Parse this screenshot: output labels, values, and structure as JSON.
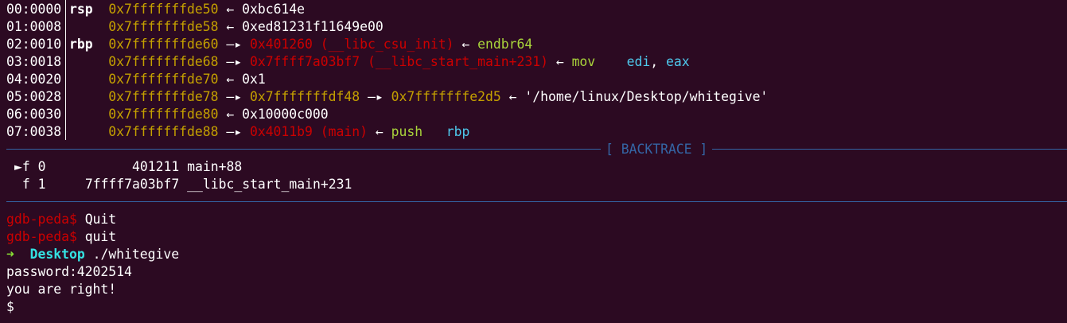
{
  "stack": [
    {
      "offset": "00:0000",
      "reg": "rsp",
      "addr": "0x7fffffffde50",
      "arrow": "←",
      "val": "0xbc614e"
    },
    {
      "offset": "01:0008",
      "reg": "",
      "addr": "0x7fffffffde58",
      "arrow": "←",
      "val": "0xed81231f11649e00"
    },
    {
      "offset": "02:0010",
      "reg": "rbp",
      "addr": "0x7fffffffde60",
      "arrow": "—▸",
      "val": "0x401260 (__libc_csu_init)",
      "arrow2": "←",
      "instr": "endbr64"
    },
    {
      "offset": "03:0018",
      "reg": "",
      "addr": "0x7fffffffde68",
      "arrow": "—▸",
      "val": "0x7ffff7a03bf7 (__libc_start_main+231)",
      "arrow2": "←",
      "instr": "mov",
      "op1": "edi",
      "comma": ",",
      "op2": "eax"
    },
    {
      "offset": "04:0020",
      "reg": "",
      "addr": "0x7fffffffde70",
      "arrow": "←",
      "val": "0x1"
    },
    {
      "offset": "05:0028",
      "reg": "",
      "addr": "0x7fffffffde78",
      "arrow": "—▸",
      "val": "0x7fffffffdf48",
      "arrow2": "—▸",
      "val2": "0x7fffffffe2d5",
      "arrow3": "←",
      "str": "'/home/linux/Desktop/whitegive'"
    },
    {
      "offset": "06:0030",
      "reg": "",
      "addr": "0x7fffffffde80",
      "arrow": "←",
      "val": "0x10000c000"
    },
    {
      "offset": "07:0038",
      "reg": "",
      "addr": "0x7fffffffde88",
      "arrow": "—▸",
      "val": "0x4011b9 (main)",
      "arrow2": "←",
      "instr": "push",
      "op1": "rbp"
    }
  ],
  "backtrace": {
    "title": "[ BACKTRACE ]",
    "frames": [
      {
        "marker": "►",
        "frame": "f 0",
        "addr": "401211",
        "sym": "main+88"
      },
      {
        "marker": "",
        "frame": "f 1",
        "addr": "7ffff7a03bf7",
        "sym": "__libc_start_main+231"
      }
    ]
  },
  "console": {
    "prompt": "gdb-peda$",
    "cmd1": "Quit",
    "cmd2": "quit",
    "shell_arrow": "➜",
    "shell_dir": "Desktop",
    "shell_cmd": "./whitegive",
    "out1": "password:4202514",
    "out2": "you are right!",
    "shell_prompt": "$"
  },
  "colors": {
    "background": "#2c0a22",
    "address_yellow": "#c4a000",
    "code_red": "#cc0000",
    "instruction_green": "#a8d33b",
    "operand_blue": "#4ec8ec",
    "separator_blue": "#3465a4"
  }
}
